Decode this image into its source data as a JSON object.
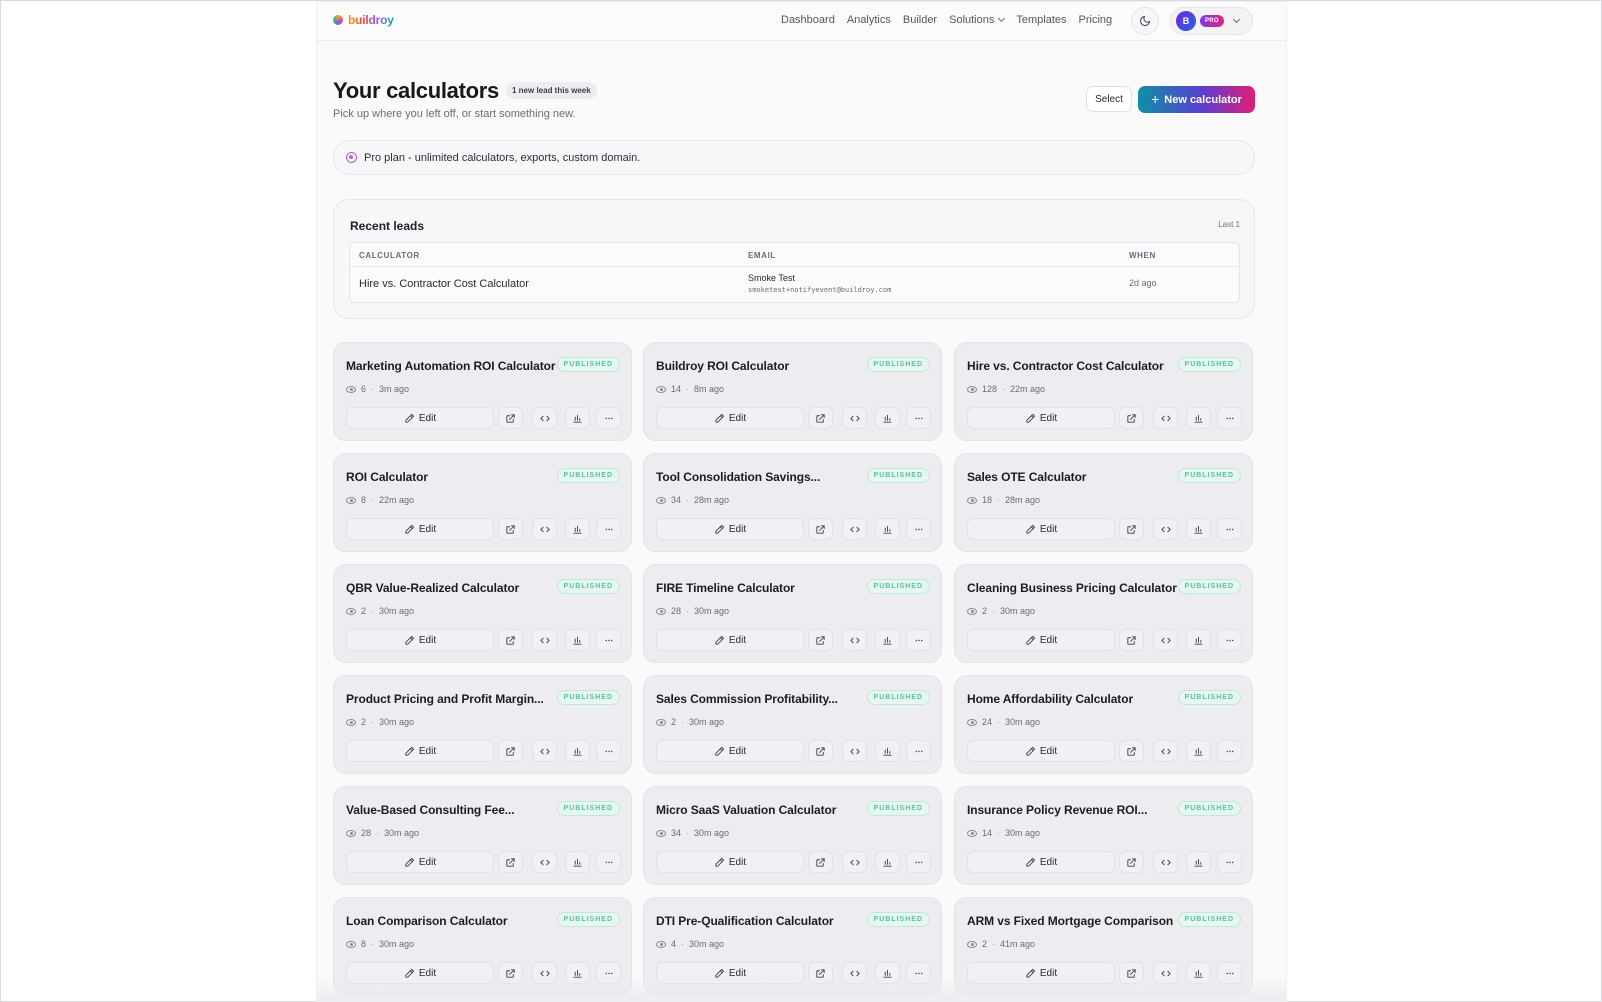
{
  "brand": {
    "name": "buildroy"
  },
  "nav": {
    "links": [
      "Dashboard",
      "Analytics",
      "Builder",
      "Solutions",
      "Templates",
      "Pricing"
    ],
    "user_initial": "B",
    "plan_badge": "PRO"
  },
  "header": {
    "title": "Your calculators",
    "lead_badge": "1 new lead this week",
    "subtitle": "Pick up where you left off, or start something new.",
    "select_label": "Select",
    "new_label": "New calculator"
  },
  "plan_banner": {
    "text": "Pro plan - unlimited calculators, exports, custom domain."
  },
  "recent_leads": {
    "title": "Recent leads",
    "range": "Last 1",
    "columns": [
      "CALCULATOR",
      "EMAIL",
      "WHEN"
    ],
    "rows": [
      {
        "calculator": "Hire vs. Contractor Cost Calculator",
        "name": "Smoke Test",
        "email": "smoketest+notifyevent@buildroy.com",
        "when": "2d ago"
      }
    ]
  },
  "card_labels": {
    "status": "PUBLISHED",
    "edit": "Edit"
  },
  "calculators": [
    {
      "title": "Marketing Automation ROI Calculator",
      "views": "6",
      "time": "3m ago"
    },
    {
      "title": "Buildroy ROI Calculator",
      "views": "14",
      "time": "8m ago"
    },
    {
      "title": "Hire vs. Contractor Cost Calculator",
      "views": "128",
      "time": "22m ago"
    },
    {
      "title": "ROI Calculator",
      "views": "8",
      "time": "22m ago"
    },
    {
      "title": "Tool Consolidation Savings...",
      "views": "34",
      "time": "28m ago"
    },
    {
      "title": "Sales OTE Calculator",
      "views": "18",
      "time": "28m ago"
    },
    {
      "title": "QBR Value-Realized Calculator",
      "views": "2",
      "time": "30m ago"
    },
    {
      "title": "FIRE Timeline Calculator",
      "views": "28",
      "time": "30m ago"
    },
    {
      "title": "Cleaning Business Pricing Calculator",
      "views": "2",
      "time": "30m ago"
    },
    {
      "title": "Product Pricing and Profit Margin...",
      "views": "2",
      "time": "30m ago"
    },
    {
      "title": "Sales Commission Profitability...",
      "views": "2",
      "time": "30m ago"
    },
    {
      "title": "Home Affordability Calculator",
      "views": "24",
      "time": "30m ago"
    },
    {
      "title": "Value-Based Consulting Fee...",
      "views": "28",
      "time": "30m ago"
    },
    {
      "title": "Micro SaaS Valuation Calculator",
      "views": "34",
      "time": "30m ago"
    },
    {
      "title": "Insurance Policy Revenue ROI...",
      "views": "14",
      "time": "30m ago"
    },
    {
      "title": "Loan Comparison Calculator",
      "views": "8",
      "time": "30m ago"
    },
    {
      "title": "DTI Pre-Qualification Calculator",
      "views": "4",
      "time": "30m ago"
    },
    {
      "title": "ARM vs Fixed Mortgage Comparison",
      "views": "2",
      "time": "41m ago"
    }
  ],
  "colors": {
    "accent_start": "#0f8fa5",
    "accent_end": "#e11d74",
    "published": "#56c49c"
  }
}
